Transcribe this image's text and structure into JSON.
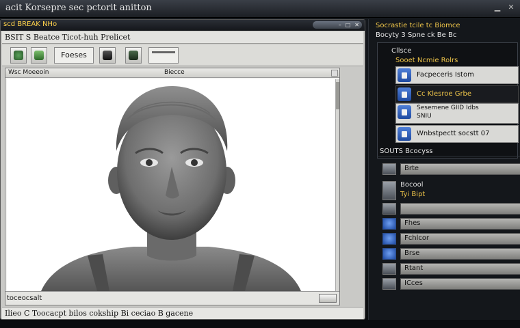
{
  "window": {
    "title": "acit Korsepre sec pctorit anitton"
  },
  "editor": {
    "header": "scd BREAK NHo",
    "menu": "BSIT S Beatce Ticot-huh Prelicet",
    "toolbar_label": "Foeses",
    "viewport": {
      "name": "Wsc Moeeoin",
      "caption": "Biecce",
      "footer": "toceocsalt"
    },
    "status": "Ilieo C Toocacpt bilos cokship Bi ceciao B gacene"
  },
  "panel": {
    "heading1": "Socrastie tcile tc Biomce",
    "heading2": "Bocyty 3 Spne ck Be Bc",
    "props": {
      "header": "Cllsce",
      "subheader": "Sooet Ncmie Rolrs",
      "rows": [
        {
          "label": "Facpeceris Istom"
        },
        {
          "label": "Cc Klesroe Grbe"
        },
        {
          "label": "Sesemene GIID Idbs",
          "label2": "SNIU"
        },
        {
          "label": "Wnbstpectt socstt 07"
        }
      ]
    },
    "layers_title": "SOUTS Bcocyss",
    "layers": [
      {
        "name": "Brte"
      },
      {
        "name": "Bocool",
        "name2": "Tyi Bipt"
      },
      {
        "name": ""
      },
      {
        "name": "Fhes"
      },
      {
        "name": "Fchlcor"
      },
      {
        "name": "Brse"
      },
      {
        "name": "Rtant"
      },
      {
        "name": "ICces"
      }
    ]
  },
  "colors": {
    "accent": "#f0c64a",
    "select": "#2f5fc0"
  }
}
